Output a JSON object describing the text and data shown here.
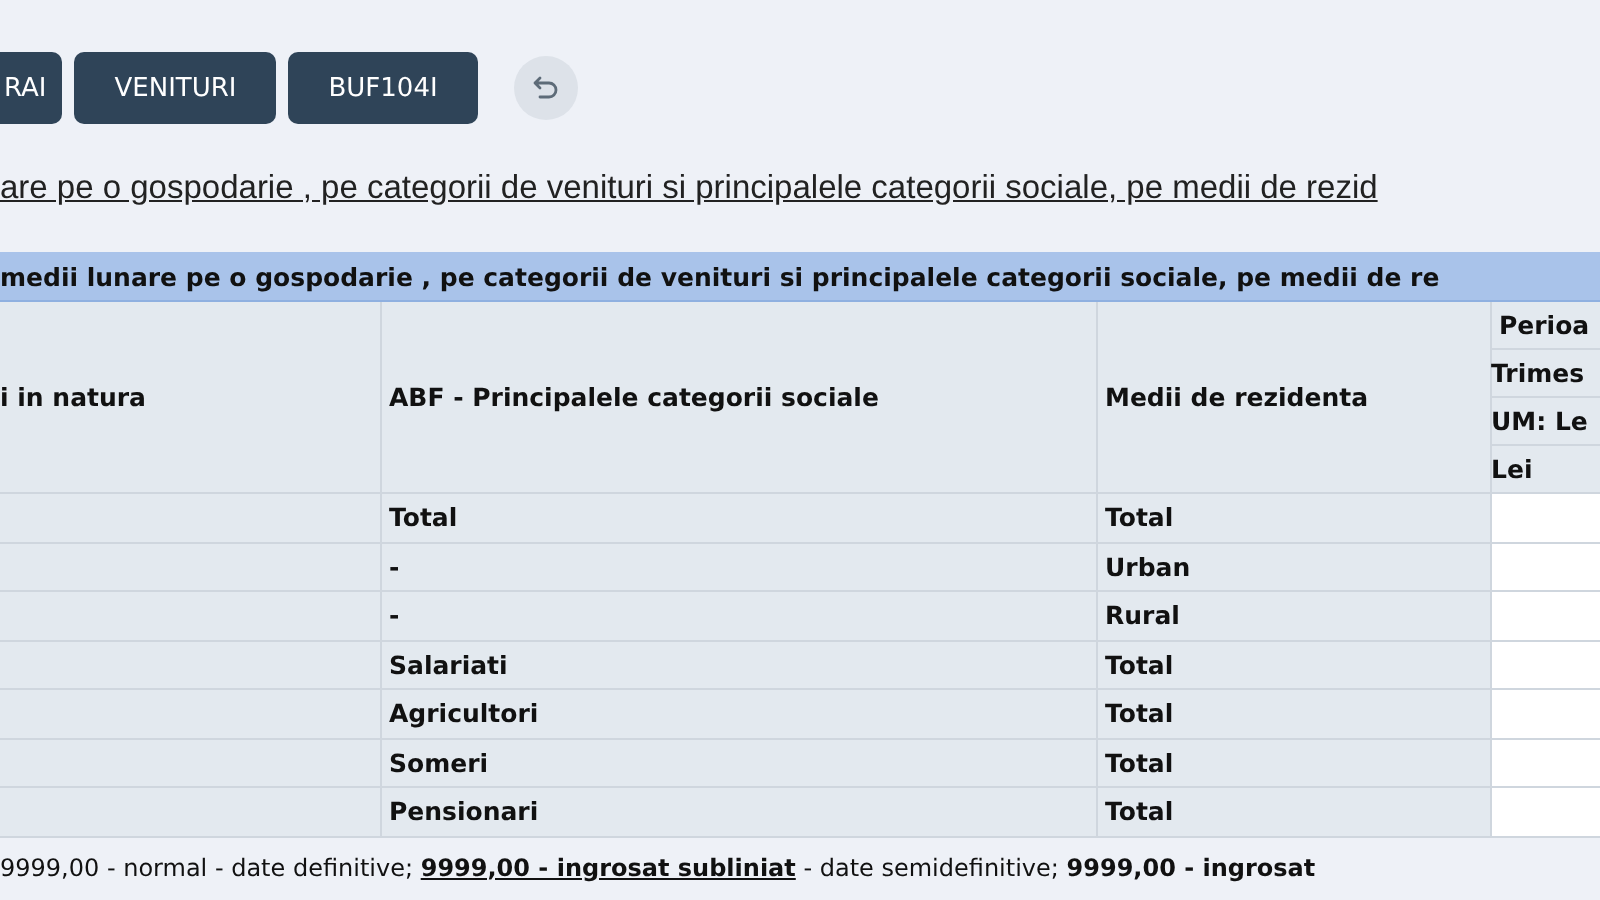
{
  "toolbar": {
    "buttons": [
      "RAI",
      "VENITURI",
      "BUF104I"
    ]
  },
  "title_link": "are pe o gospodarie , pe categorii de venituri si principalele categorii sociale, pe medii de rezid",
  "table": {
    "caption": "medii lunare pe o gospodarie , pe categorii de venituri si principalele categorii sociale, pe medii de re",
    "columns": [
      "i in natura",
      "ABF - Principalele categorii sociale",
      "Medii de rezidenta"
    ],
    "column_4_headers": [
      "Perioa",
      "Trimes",
      "UM: Le",
      "Lei"
    ],
    "rows": [
      {
        "column_2": "Total",
        "column_3": "Total"
      },
      {
        "column_2": "-",
        "column_3": "Urban"
      },
      {
        "column_2": "-",
        "column_3": "Rural"
      },
      {
        "column_2": "Salariati",
        "column_3": "Total"
      },
      {
        "column_2": "Agricultori",
        "column_3": "Total"
      },
      {
        "column_2": "Someri",
        "column_3": "Total"
      },
      {
        "column_2": "Pensionari",
        "column_3": "Total"
      }
    ]
  },
  "legend": [
    {
      "kind": "plain",
      "text": "9999,00 - normal - date definitive; "
    },
    {
      "kind": "bold-underline",
      "text": "9999,00 - ingrosat subliniat"
    },
    {
      "kind": "plain",
      "text": " - date semidefinitive; "
    },
    {
      "kind": "bold",
      "text": "9999,00 - ingrosat"
    }
  ]
}
